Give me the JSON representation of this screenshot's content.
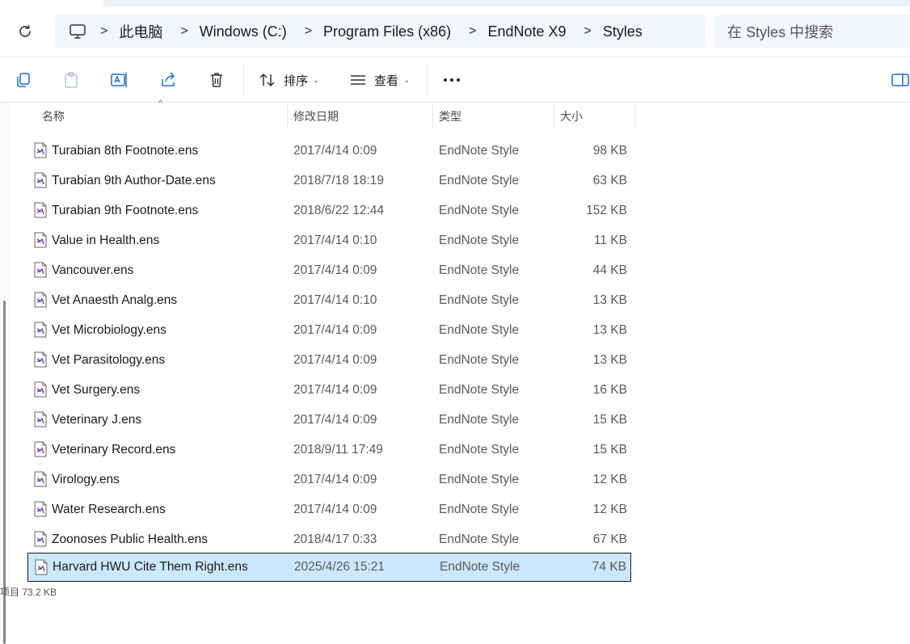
{
  "address": {
    "breadcrumbs": [
      "此电脑",
      "Windows (C:)",
      "Program Files (x86)",
      "EndNote X9",
      "Styles"
    ],
    "search_placeholder": "在 Styles 中搜索"
  },
  "toolbar": {
    "sort_label": "排序",
    "view_label": "查看",
    "more_label": "•••"
  },
  "columns": {
    "name": "名称",
    "date": "修改日期",
    "type": "类型",
    "size": "大小"
  },
  "files": [
    {
      "name": "Turabian 8th Footnote.ens",
      "date": "2017/4/14 0:09",
      "type": "EndNote Style",
      "size": "98 KB"
    },
    {
      "name": "Turabian 9th Author-Date.ens",
      "date": "2018/7/18 18:19",
      "type": "EndNote Style",
      "size": "63 KB"
    },
    {
      "name": "Turabian 9th Footnote.ens",
      "date": "2018/6/22 12:44",
      "type": "EndNote Style",
      "size": "152 KB"
    },
    {
      "name": "Value in Health.ens",
      "date": "2017/4/14 0:10",
      "type": "EndNote Style",
      "size": "11 KB"
    },
    {
      "name": "Vancouver.ens",
      "date": "2017/4/14 0:09",
      "type": "EndNote Style",
      "size": "44 KB"
    },
    {
      "name": "Vet Anaesth Analg.ens",
      "date": "2017/4/14 0:10",
      "type": "EndNote Style",
      "size": "13 KB"
    },
    {
      "name": "Vet Microbiology.ens",
      "date": "2017/4/14 0:09",
      "type": "EndNote Style",
      "size": "13 KB"
    },
    {
      "name": "Vet Parasitology.ens",
      "date": "2017/4/14 0:09",
      "type": "EndNote Style",
      "size": "13 KB"
    },
    {
      "name": "Vet Surgery.ens",
      "date": "2017/4/14 0:09",
      "type": "EndNote Style",
      "size": "16 KB"
    },
    {
      "name": "Veterinary J.ens",
      "date": "2017/4/14 0:09",
      "type": "EndNote Style",
      "size": "15 KB"
    },
    {
      "name": "Veterinary Record.ens",
      "date": "2018/9/11 17:49",
      "type": "EndNote Style",
      "size": "15 KB"
    },
    {
      "name": "Virology.ens",
      "date": "2017/4/14 0:09",
      "type": "EndNote Style",
      "size": "12 KB"
    },
    {
      "name": "Water Research.ens",
      "date": "2017/4/14 0:09",
      "type": "EndNote Style",
      "size": "12 KB"
    },
    {
      "name": "Zoonoses Public Health.ens",
      "date": "2018/4/17 0:33",
      "type": "EndNote Style",
      "size": "67 KB"
    },
    {
      "name": "Harvard HWU Cite Them Right.ens",
      "date": "2025/4/26 15:21",
      "type": "EndNote Style",
      "size": "74 KB",
      "selected": true
    }
  ],
  "status": {
    "text": "项目 73.2 KB"
  },
  "colors": {
    "selection": "#cce8ff",
    "address_bg": "#f3f6fb",
    "icon_accent": "#6b3fa0"
  }
}
